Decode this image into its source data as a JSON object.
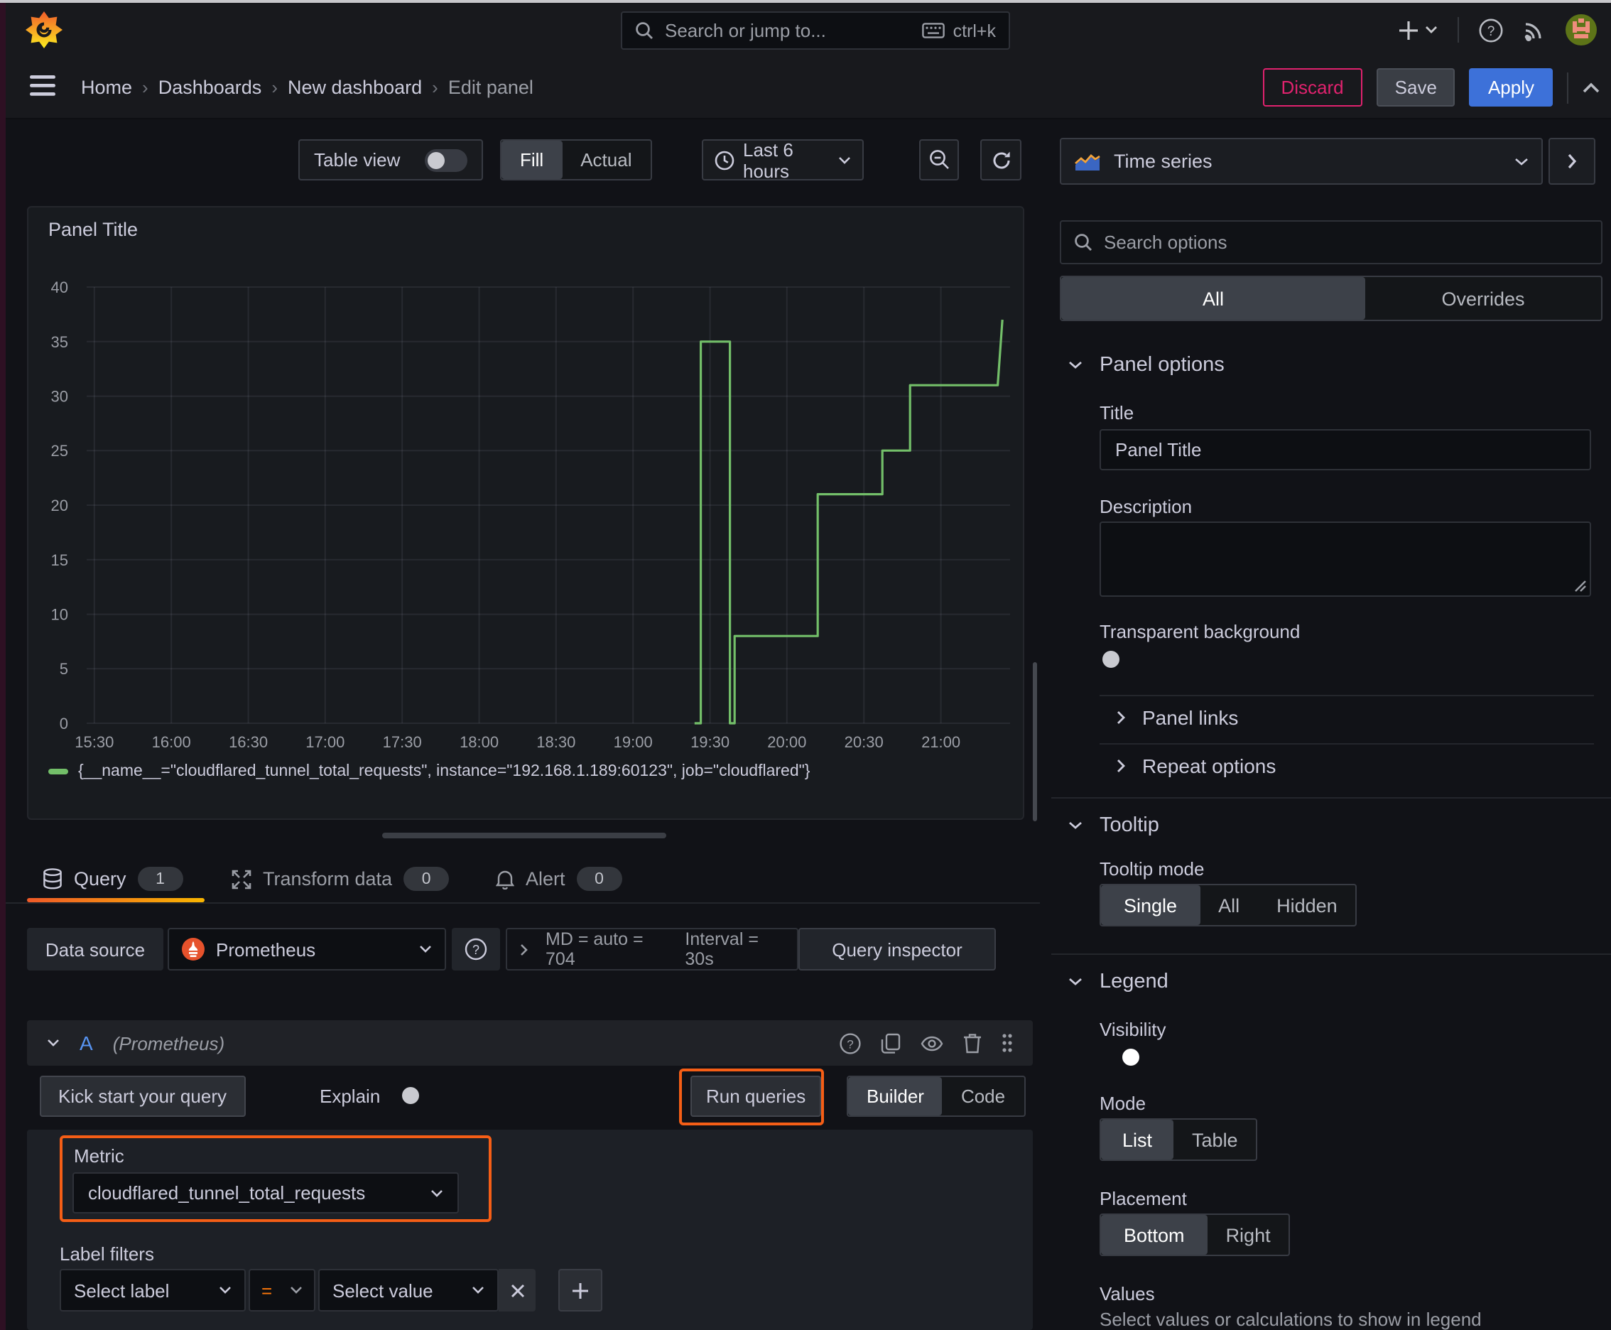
{
  "colors": {
    "green": "#73BF69",
    "orange_accent": "#FF780A",
    "highlight_orange": "#F55E16",
    "blue": "#3D71D9",
    "pink": "#E0226E",
    "ref_blue": "#5794F2"
  },
  "topbar": {
    "search_placeholder": "Search or jump to...",
    "shortcut": "ctrl+k"
  },
  "breadcrumb": {
    "items": [
      "Home",
      "Dashboards",
      "New dashboard",
      "Edit panel"
    ]
  },
  "actions": {
    "discard": "Discard",
    "save": "Save",
    "apply": "Apply"
  },
  "toolbar": {
    "table_view": "Table view",
    "fill": "Fill",
    "actual": "Actual",
    "time_range": "Last 6 hours"
  },
  "panel": {
    "title": "Panel Title"
  },
  "chart_data": {
    "type": "line",
    "title": "Panel Title",
    "xlabel": "",
    "ylabel": "",
    "x_axis": {
      "min_h": 15.45,
      "max_h": 21.45,
      "ticks": [
        {
          "h": 15.5,
          "label": "15:30"
        },
        {
          "h": 16.0,
          "label": "16:00"
        },
        {
          "h": 16.5,
          "label": "16:30"
        },
        {
          "h": 17.0,
          "label": "17:00"
        },
        {
          "h": 17.5,
          "label": "17:30"
        },
        {
          "h": 18.0,
          "label": "18:00"
        },
        {
          "h": 18.5,
          "label": "18:30"
        },
        {
          "h": 19.0,
          "label": "19:00"
        },
        {
          "h": 19.5,
          "label": "19:30"
        },
        {
          "h": 20.0,
          "label": "20:00"
        },
        {
          "h": 20.5,
          "label": "20:30"
        },
        {
          "h": 21.0,
          "label": "21:00"
        }
      ]
    },
    "y_axis": {
      "min": 0,
      "max": 40,
      "ticks": [
        0,
        5,
        10,
        15,
        20,
        25,
        30,
        35,
        40
      ]
    },
    "grid": true,
    "legend_position": "bottom",
    "series": [
      {
        "name": "{__name__=\"cloudflared_tunnel_total_requests\", instance=\"192.168.1.189:60123\", job=\"cloudflared\"}",
        "color": "#73BF69",
        "step": true,
        "points": [
          [
            19.4,
            0
          ],
          [
            19.44,
            0
          ],
          [
            19.44,
            35
          ],
          [
            19.63,
            35
          ],
          [
            19.63,
            0
          ],
          [
            19.66,
            0
          ],
          [
            19.66,
            8
          ],
          [
            20.2,
            8
          ],
          [
            20.2,
            21
          ],
          [
            20.62,
            21
          ],
          [
            20.62,
            25
          ],
          [
            20.8,
            25
          ],
          [
            20.8,
            31
          ],
          [
            21.37,
            31
          ],
          [
            21.4,
            37
          ]
        ]
      }
    ]
  },
  "tabs": {
    "query": {
      "label": "Query",
      "count": "1"
    },
    "transform": {
      "label": "Transform data",
      "count": "0"
    },
    "alert": {
      "label": "Alert",
      "count": "0"
    }
  },
  "datasource_row": {
    "label": "Data source",
    "value": "Prometheus",
    "max_data_points": "MD = auto = 704",
    "interval": "Interval = 30s",
    "inspector": "Query inspector"
  },
  "query_a": {
    "ref_id": "A",
    "datasource": "(Prometheus)"
  },
  "query_toolbar": {
    "kickstart": "Kick start your query",
    "explain": "Explain",
    "run": "Run queries",
    "builder": "Builder",
    "code": "Code"
  },
  "builder": {
    "metric_label": "Metric",
    "metric_value": "cloudflared_tunnel_total_requests",
    "label_filters_label": "Label filters",
    "select_label": "Select label",
    "operator": "=",
    "select_value": "Select value"
  },
  "options_pane": {
    "viz": "Time series",
    "search_placeholder": "Search options",
    "tab_all": "All",
    "tab_overrides": "Overrides",
    "panel_options": {
      "header": "Panel options",
      "title_label": "Title",
      "title_value": "Panel Title",
      "description_label": "Description",
      "transparent_label": "Transparent background",
      "links": "Panel links",
      "repeat": "Repeat options"
    },
    "tooltip": {
      "header": "Tooltip",
      "mode_label": "Tooltip mode",
      "modes": [
        "Single",
        "All",
        "Hidden"
      ]
    },
    "legend": {
      "header": "Legend",
      "visibility_label": "Visibility",
      "mode_label": "Mode",
      "modes": [
        "List",
        "Table"
      ],
      "placement_label": "Placement",
      "placements": [
        "Bottom",
        "Right"
      ],
      "values_label": "Values",
      "values_desc": "Select values or calculations to show in legend"
    }
  }
}
